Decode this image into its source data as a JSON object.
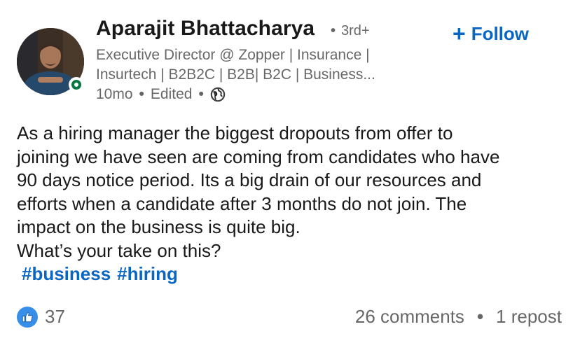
{
  "author": {
    "name": "Aparajit Bhattacharya",
    "degree": "3rd+",
    "degree_separator": "•",
    "headline_lines": [
      "Executive Director @ Zopper | Insurance |",
      "Insurtech | B2B2C | B2B| B2C | Business..."
    ],
    "online_status": "online"
  },
  "actions": {
    "follow_label": "Follow",
    "follow_plus": "+"
  },
  "meta": {
    "time": "10mo",
    "edited": "Edited",
    "separator": "•",
    "visibility_icon": "globe-icon"
  },
  "post": {
    "lines": [
      "As a hiring manager the biggest dropouts from offer to",
      "joining we have seen are coming from candidates who have",
      "90 days notice period. Its a big drain of our resources and",
      "efforts when a candidate after 3 months do not join. The",
      "impact on the business is quite big.",
      "What’s your take on this?"
    ],
    "hashtags": [
      "#business",
      "#hiring"
    ]
  },
  "social": {
    "reaction_icon": "like-icon",
    "reactions_count": "37",
    "comments": "26 comments",
    "separator": "•",
    "reposts": "1 repost"
  },
  "colors": {
    "accent": "#0a66c2",
    "like_blue": "#378fe9",
    "online_green": "#057642",
    "muted_text": "rgba(0,0,0,0.6)"
  }
}
